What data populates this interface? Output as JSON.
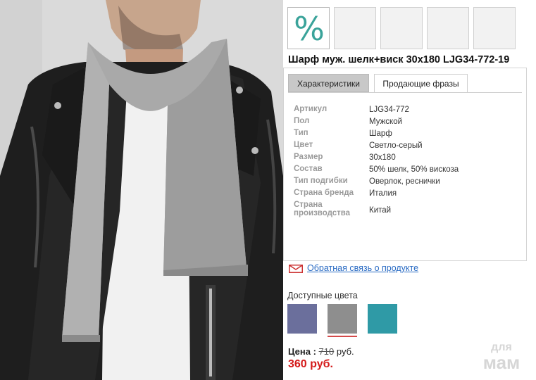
{
  "thumbnails": {
    "active_symbol": "%",
    "count": 5
  },
  "product": {
    "title": "Шарф муж. шелк+виск 30x180 LJG34-772-19"
  },
  "tabs": [
    {
      "label": "Характеристики",
      "active": true
    },
    {
      "label": "Продающие фразы",
      "active": false
    }
  ],
  "specs": [
    {
      "key": "Артикул",
      "value": "LJG34-772"
    },
    {
      "key": "Пол",
      "value": "Мужской"
    },
    {
      "key": "Тип",
      "value": "Шарф"
    },
    {
      "key": "Цвет",
      "value": "Светло-серый"
    },
    {
      "key": "Размер",
      "value": "30x180"
    },
    {
      "key": "Состав",
      "value": "50% шелк, 50% вискоза"
    },
    {
      "key": "Тип подгибки",
      "value": "Оверлок, реснички"
    },
    {
      "key": "Страна бренда",
      "value": "Италия"
    },
    {
      "key": "Страна производства",
      "value": "Китай"
    }
  ],
  "feedback": {
    "label": "Обратная связь о продукте",
    "icon": "mail-icon"
  },
  "colors": {
    "label": "Доступные цвета",
    "swatches": [
      {
        "name": "lavender",
        "hex": "#6b6f9c",
        "selected": false
      },
      {
        "name": "gray",
        "hex": "#8e8e8e",
        "selected": true
      },
      {
        "name": "teal",
        "hex": "#2f9aa6",
        "selected": false
      }
    ]
  },
  "price": {
    "label": "Цена :",
    "old_value": "710",
    "old_unit": "руб.",
    "new_price": "360 руб."
  },
  "watermark": {
    "line1": "для",
    "line2": "мам"
  },
  "accent_colors": {
    "percent": "#3aa39a",
    "link": "#2b6cc4",
    "new_price": "#d41a1a"
  }
}
